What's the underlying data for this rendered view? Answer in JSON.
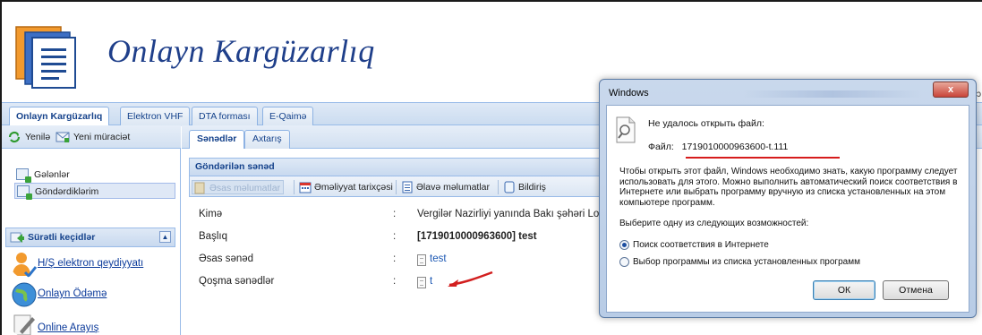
{
  "app": {
    "title": "Onlayn Kargüzarlıq"
  },
  "top_tabs": [
    "Onlayn Kargüzarlıq",
    "Elektron VHF",
    "DTA forması",
    "E-Qaimə"
  ],
  "left_toolbar": {
    "refresh": "Yenilə",
    "new_request": "Yeni müraciət"
  },
  "left_nav": [
    "Gələnlər",
    "Göndərdiklərim"
  ],
  "quick_links": {
    "header": "Sürətli keçidlər",
    "items": [
      "H/Ş elektron qeydiyyatı",
      "Onlayn Ödəmə",
      "Online Arayış"
    ]
  },
  "sub_tabs": [
    "Sənədlər",
    "Axtarış"
  ],
  "panel": {
    "title": "Göndərilən sənəd",
    "toolbar": [
      "Əsas məlumatlar",
      "Əməliyyat tarixçəsi",
      "Əlavə məlumatlar",
      "Bildiriş"
    ]
  },
  "details": [
    {
      "label": "Kimə",
      "value": "Vergilər Nazirliyi yanında Bakı şəhəri Lo"
    },
    {
      "label": "Başlıq",
      "value": "[1719010000963600] test"
    },
    {
      "label": "Əsas sənəd",
      "value": "test"
    },
    {
      "label": "Qoşma sənədlər",
      "value": "t"
    }
  ],
  "dialog": {
    "title": "Windows",
    "close": "x",
    "message": "Не удалось открыть файл:",
    "file_label": "Файл:",
    "file_name": "1719010000963600-t.111",
    "description": "Чтобы открыть этот файл, Windows необходимо знать, какую программу следует использовать для этого. Можно выполнить автоматический поиск соответствия в Интернете или выбрать программу вручную из списка установленных на этом компьютере программ.",
    "prompt": "Выберите одну из следующих возможностей:",
    "options": [
      {
        "label": "Поиск соответствия в Интернете",
        "selected": true
      },
      {
        "label": "Выбор программы из списка установленных программ",
        "selected": false
      }
    ],
    "ok": "ОК",
    "cancel": "Отмена"
  },
  "edge_text": "ɔ"
}
